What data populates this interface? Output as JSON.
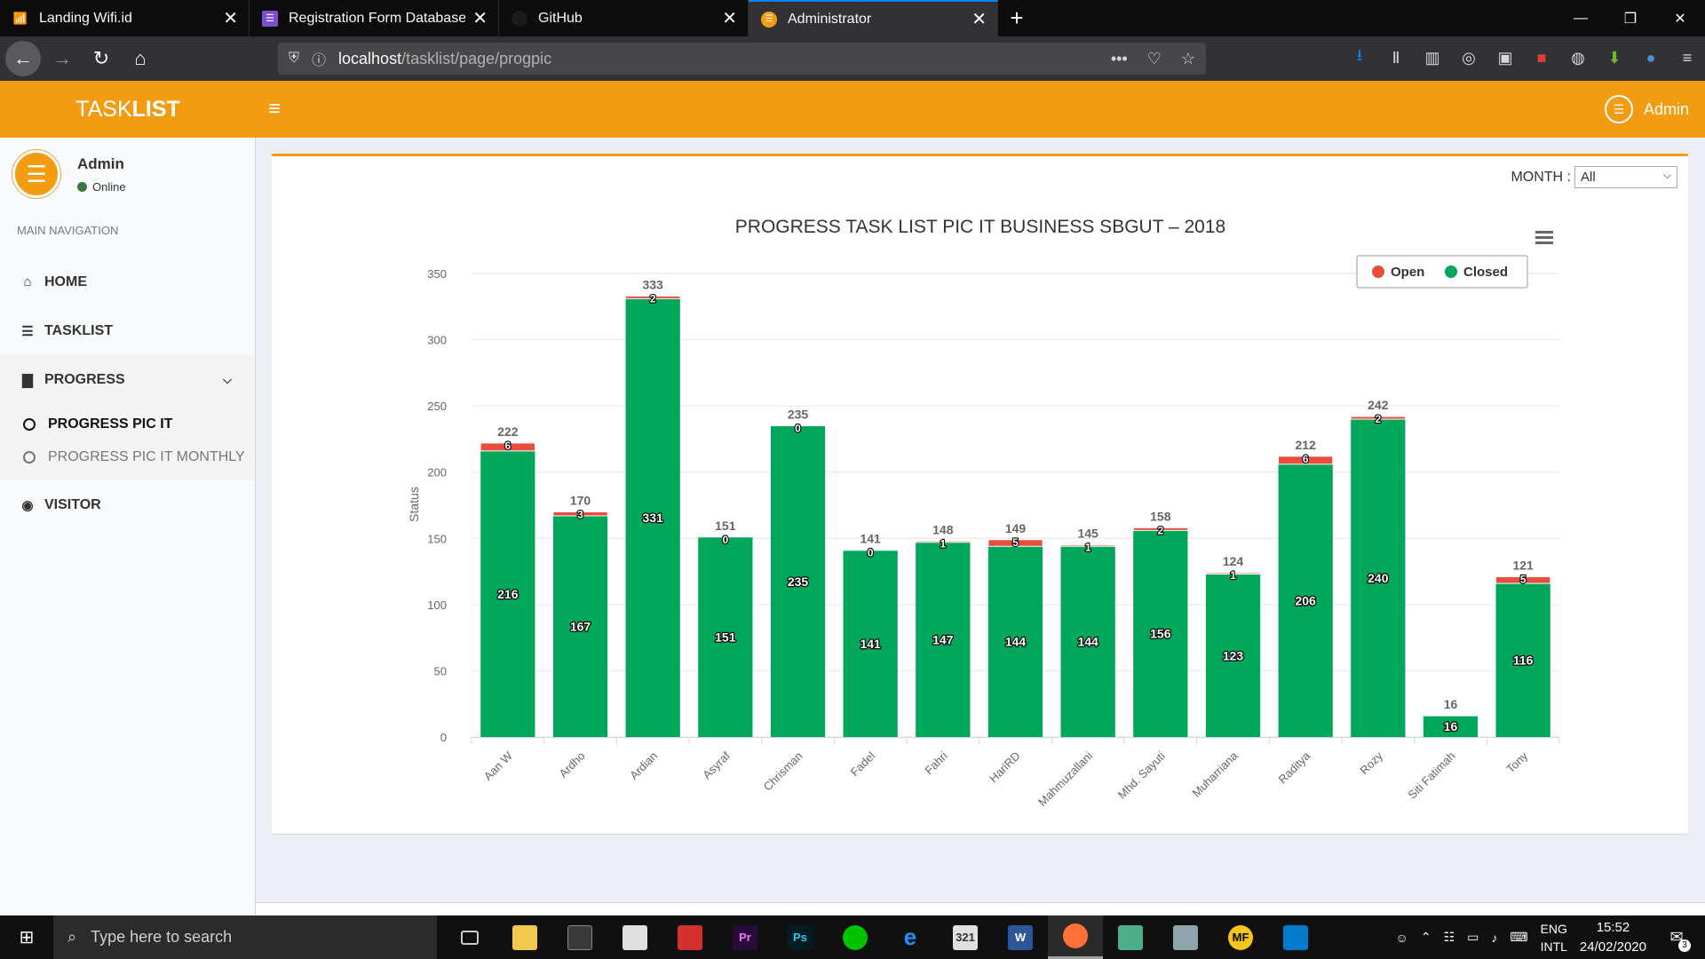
{
  "browser": {
    "tabs": [
      {
        "title": "Landing Wifi.id",
        "icon": "wifi-icon",
        "color": "#e53935"
      },
      {
        "title": "Registration Form Database La",
        "icon": "form-icon",
        "color": "#7b4fcf"
      },
      {
        "title": "GitHub",
        "icon": "github-icon",
        "color": "#24292e"
      },
      {
        "title": "Administrator",
        "icon": "admin-icon",
        "color": "#f39c12"
      }
    ],
    "url_host": "localhost",
    "url_path": "/tasklist/page/progpic"
  },
  "app": {
    "logo_light": "TASK",
    "logo_bold": "LIST",
    "header_user": "Admin",
    "brand_color": "#f39c12"
  },
  "sidebar": {
    "user_name": "Admin",
    "user_status": "Online",
    "nav_header": "MAIN NAVIGATION",
    "items": [
      {
        "label": "HOME",
        "icon": "home-icon"
      },
      {
        "label": "TASKLIST",
        "icon": "list-icon"
      },
      {
        "label": "PROGRESS",
        "icon": "bar-chart-icon"
      },
      {
        "label": "VISITOR",
        "icon": "eye-icon"
      }
    ],
    "progress_sub": [
      {
        "label": "PROGRESS PIC IT",
        "active": true
      },
      {
        "label": "PROGRESS PIC IT MONTHLY",
        "active": false
      }
    ]
  },
  "filter": {
    "label": "MONTH :",
    "selected": "All"
  },
  "chart_data": {
    "type": "bar",
    "stacked": true,
    "title": "PROGRESS TASK LIST PIC IT BUSINESS SBGUT – 2018",
    "ylabel": "Status",
    "xlabel": "",
    "ylim": [
      0,
      350
    ],
    "yticks": [
      0,
      50,
      100,
      150,
      200,
      250,
      300,
      350
    ],
    "grid": true,
    "legend_position": "top-right",
    "categories": [
      "Aan W",
      "Ardho",
      "Ardian",
      "Asyraf",
      "Chrisman",
      "Fadel",
      "Fahri",
      "HariRD",
      "Mahmuzallani",
      "Mhd. Sayuti",
      "Muharriana",
      "Raditya",
      "Rozy",
      "Siti Fatimah",
      "Tony"
    ],
    "series": [
      {
        "name": "Open",
        "color": "#e74c3c",
        "values": [
          6,
          3,
          2,
          0,
          0,
          0,
          1,
          5,
          1,
          2,
          1,
          6,
          2,
          0,
          5
        ]
      },
      {
        "name": "Closed",
        "color": "#00a65a",
        "values": [
          216,
          167,
          331,
          151,
          235,
          141,
          147,
          144,
          144,
          156,
          123,
          206,
          240,
          16,
          116
        ]
      }
    ],
    "totals": [
      222,
      170,
      333,
      151,
      235,
      141,
      148,
      149,
      145,
      158,
      124,
      212,
      242,
      16,
      121
    ],
    "open_labels_shown": [
      true,
      true,
      true,
      true,
      true,
      true,
      true,
      true,
      true,
      true,
      true,
      true,
      true,
      false,
      true
    ]
  },
  "taskbar": {
    "search_placeholder": "Type here to search",
    "lang_top": "ENG",
    "lang_bottom": "INTL",
    "time": "15:52",
    "date": "24/02/2020",
    "notif_count": "3"
  }
}
